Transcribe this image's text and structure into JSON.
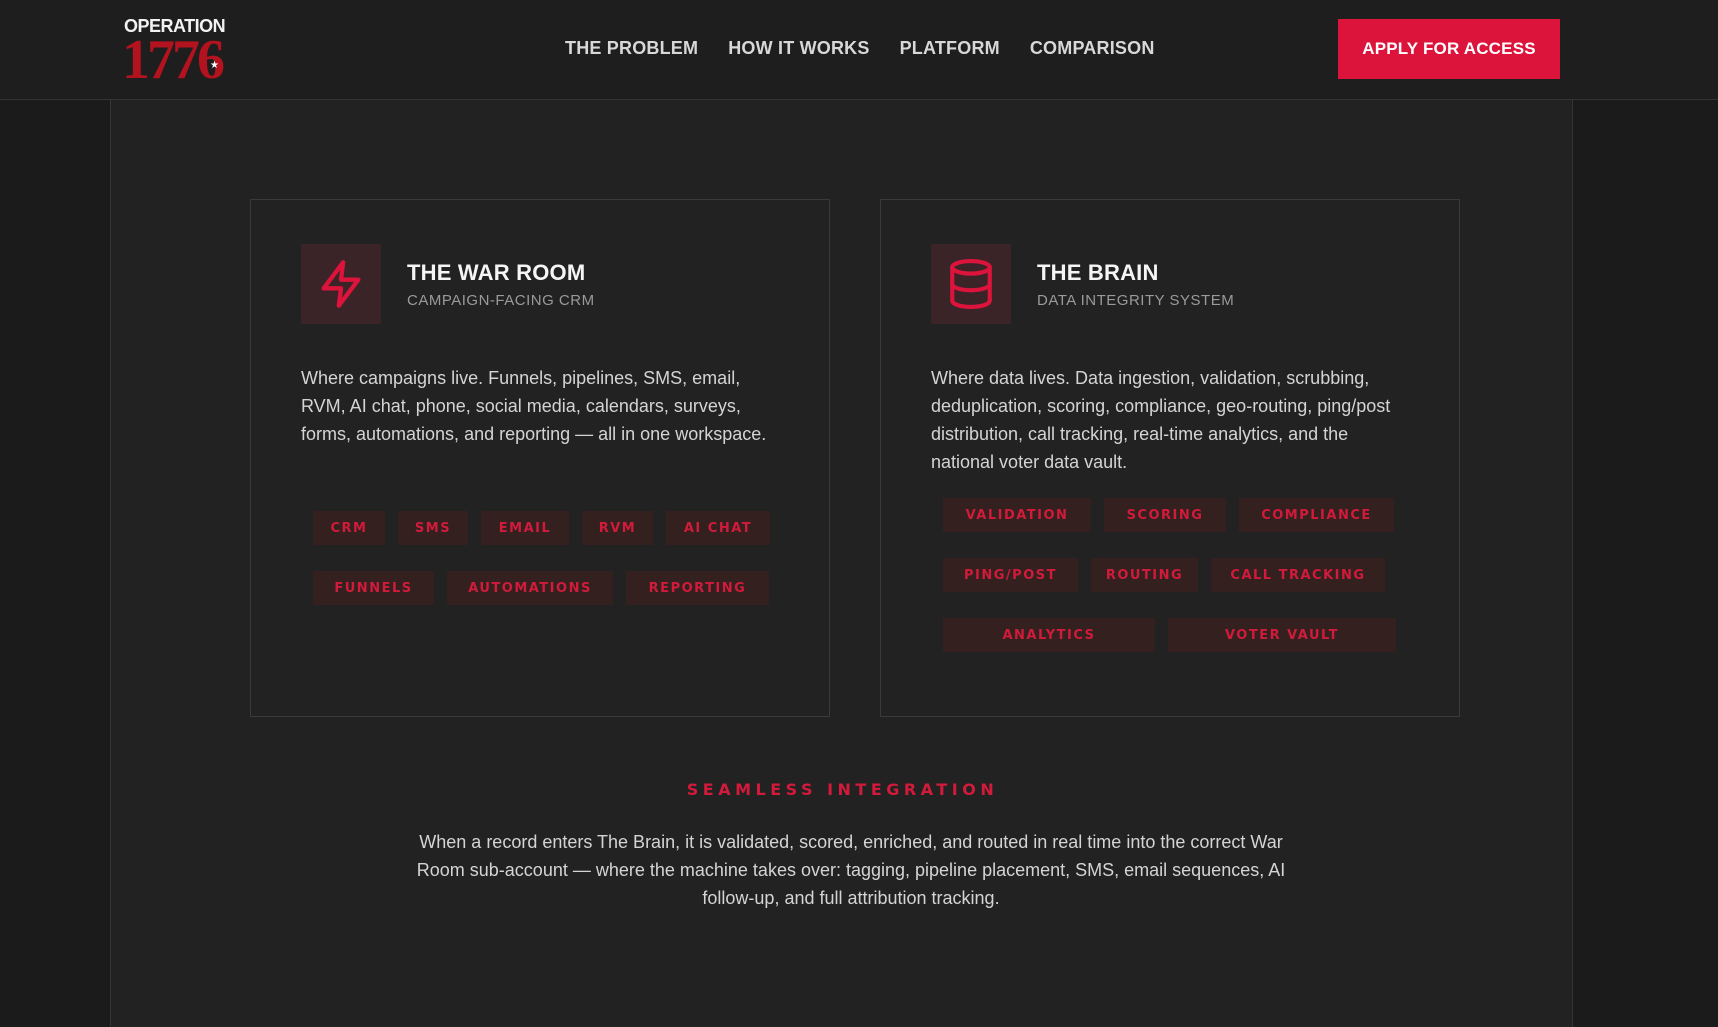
{
  "header": {
    "logo_top": "OPERATION",
    "logo_number": "1776",
    "nav": [
      {
        "label": "THE PROBLEM"
      },
      {
        "label": "HOW IT WORKS"
      },
      {
        "label": "PLATFORM"
      },
      {
        "label": "COMPARISON"
      }
    ],
    "cta_label": "APPLY FOR ACCESS"
  },
  "cards": [
    {
      "icon": "lightning-icon",
      "title": "THE WAR ROOM",
      "subtitle": "CAMPAIGN-FACING CRM",
      "description": "Where campaigns live. Funnels, pipelines, SMS, email, RVM, AI chat, phone, social media, calendars, surveys, forms, automations, and reporting — all in one workspace.",
      "tags": [
        "CRM",
        "SMS",
        "EMAIL",
        "RVM",
        "AI CHAT",
        "FUNNELS",
        "AUTOMATIONS",
        "REPORTING"
      ]
    },
    {
      "icon": "database-icon",
      "title": "THE BRAIN",
      "subtitle": "DATA INTEGRITY SYSTEM",
      "description": "Where data lives. Data ingestion, validation, scrubbing, deduplication, scoring, compliance, geo-routing, ping/post distribution, call tracking, real-time analytics, and the national voter data vault.",
      "tags": [
        "VALIDATION",
        "SCORING",
        "COMPLIANCE",
        "PING/POST",
        "ROUTING",
        "CALL TRACKING",
        "ANALYTICS",
        "VOTER VAULT"
      ]
    }
  ],
  "integration": {
    "label": "SEAMLESS INTEGRATION",
    "text": "When a record enters The Brain, it is validated, scored, enriched, and routed in real time into the correct War Room sub-account — where the machine takes over: tagging, pipeline placement, SMS, email sequences, AI follow-up, and full attribution tracking."
  },
  "colors": {
    "accent": "#dc143c",
    "background": "#222222",
    "tag_background": "#34211f"
  }
}
